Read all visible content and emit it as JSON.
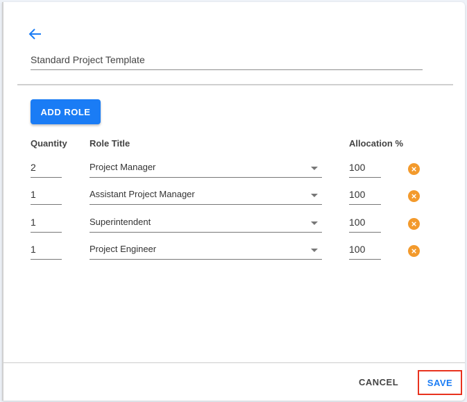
{
  "template_name": "Standard Project Template",
  "add_role_label": "ADD ROLE",
  "headers": {
    "quantity": "Quantity",
    "role_title": "Role Title",
    "allocation": "Allocation %"
  },
  "roles": [
    {
      "quantity": "2",
      "role": "Project Manager",
      "allocation": "100"
    },
    {
      "quantity": "1",
      "role": "Assistant Project Manager",
      "allocation": "100"
    },
    {
      "quantity": "1",
      "role": "Superintendent",
      "allocation": "100"
    },
    {
      "quantity": "1",
      "role": "Project Engineer",
      "allocation": "100"
    }
  ],
  "footer": {
    "cancel_label": "CANCEL",
    "save_label": "SAVE"
  },
  "colors": {
    "accent": "#1a7cf5",
    "remove": "#f39a2c",
    "highlight": "#e8321e"
  }
}
